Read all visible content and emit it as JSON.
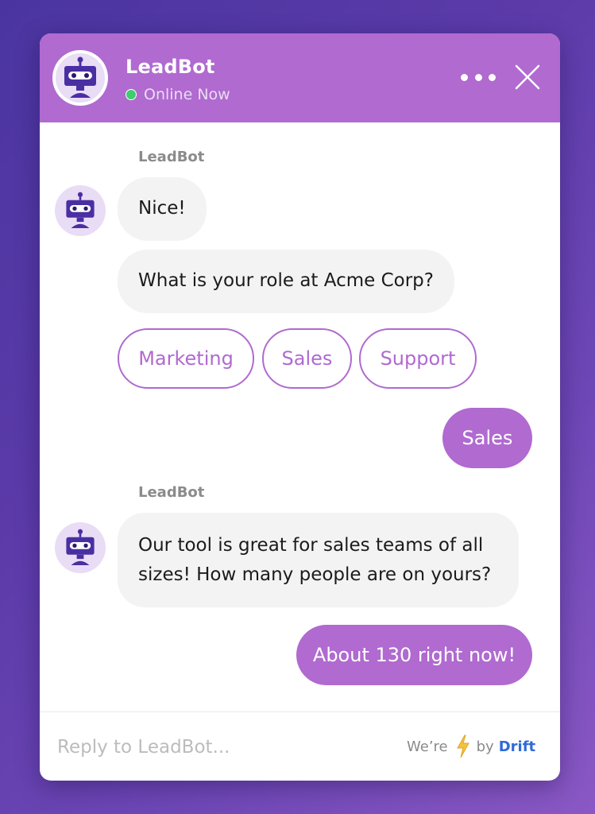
{
  "header": {
    "bot_name": "LeadBot",
    "status": "Online Now",
    "status_color": "#3ccf6b",
    "accent_color": "#b06ad0"
  },
  "messages": {
    "sender_1": "LeadBot",
    "bot_1": "Nice!",
    "bot_2": "What is your role at Acme Corp?",
    "options": [
      "Marketing",
      "Sales",
      "Support"
    ],
    "user_1": "Sales",
    "sender_2": "LeadBot",
    "bot_3_line_1": "Our tool is great for sales teams of all",
    "bot_3_line_2": "sizes! How many people are on yours?",
    "user_2": "About 130 right now!"
  },
  "footer": {
    "reply_placeholder": "Reply to LeadBot...",
    "branding_prefix": "We’re",
    "branding_icon": "lightning-bolt-icon",
    "branding_by": "by",
    "branding_name": "Drift"
  }
}
